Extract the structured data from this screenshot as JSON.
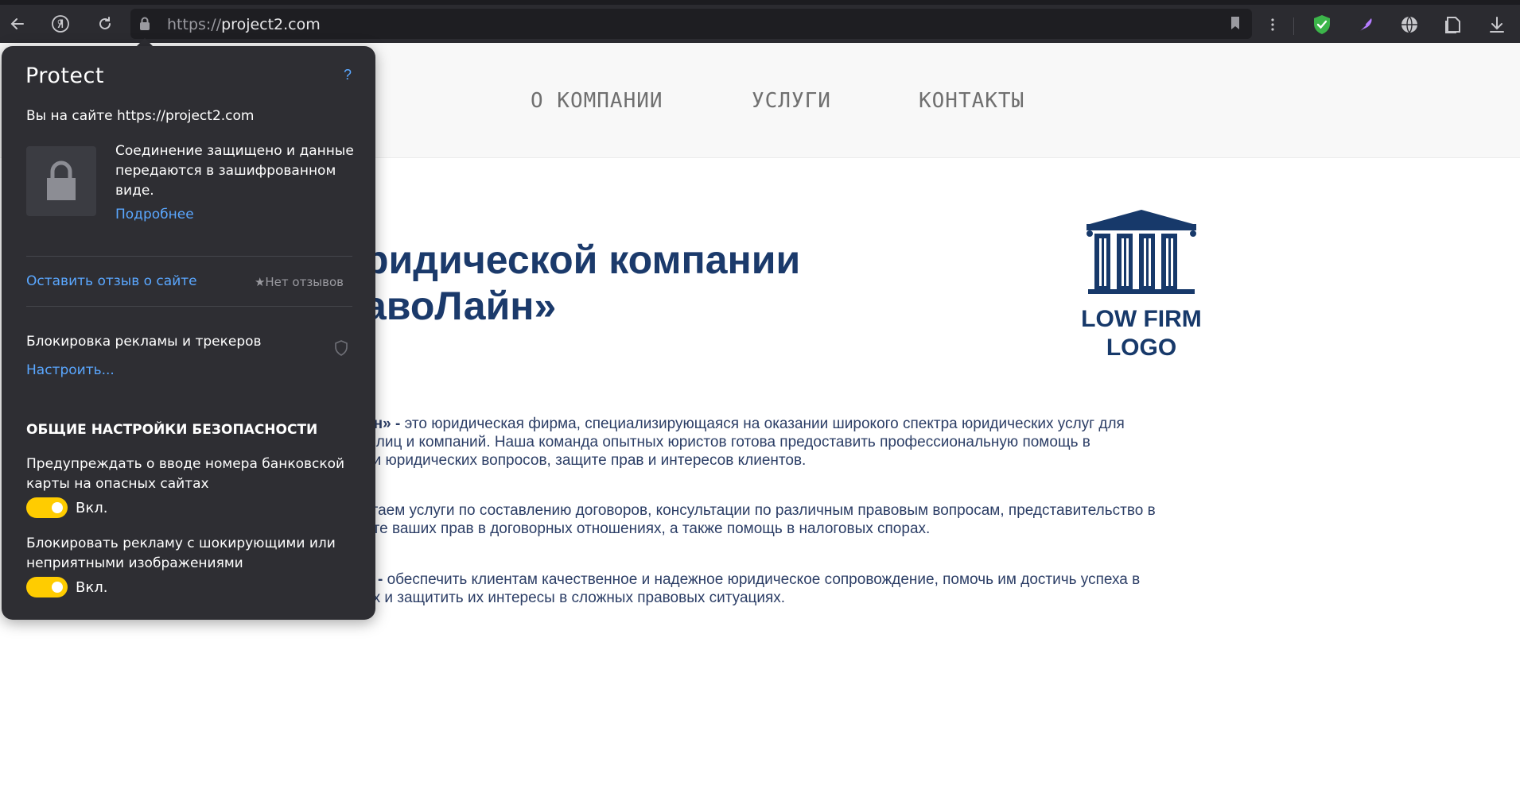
{
  "browser": {
    "url_scheme": "https://",
    "url_host": "project2.com"
  },
  "site": {
    "nav": [
      "О КОМПАНИИ",
      "УСЛУГИ",
      "КОНТАКТЫ"
    ],
    "hero_line1": "ридической компании",
    "hero_line2": "авоЛайн»",
    "logo_line1": "LOW FIRM",
    "logo_line2": "LOGO",
    "para1": {
      "line1_bold": "йн» -",
      "line1": " это юридическая фирма, специализирующаяся на оказании широкого спектра юридических услуг для",
      "line2": "х лиц и компаний. Наша команда опытных юристов готова предоставить профессиональную помощь в",
      "line3": "ии юридических вопросов, защите прав и интересов клиентов."
    },
    "para2": {
      "line1": "агаем услуги по составлению договоров, консультации по различным правовым вопросам, представительство в",
      "line2": "ите ваших прав в договорных отношениях, а также помощь в налоговых спорах."
    },
    "para3": {
      "line1_bold": "ь -",
      "line1": " обеспечить клиентам качественное и надежное юридическое сопровождение, помочь им достичь успеха в",
      "line2": "ах и защитить их интересы в сложных правовых ситуациях."
    }
  },
  "protect": {
    "title": "Protect",
    "help": "?",
    "site_line": "Вы на сайте https://project2.com",
    "connection_text": "Соединение защищено и данные передаются в зашифрованном виде.",
    "more_link": "Подробнее",
    "feedback_link": "Оставить отзыв о сайте",
    "no_reviews": "Нет отзывов",
    "block_label": "Блокировка рекламы и трекеров",
    "configure_link": "Настроить...",
    "section_title": "ОБЩИЕ НАСТРОЙКИ БЕЗОПАСНОСТИ",
    "setting1": "Предупреждать о вводе номера банковской карты на опасных сайтах",
    "setting1_state": "Вкл.",
    "setting2": "Блокировать рекламу с шокирующими или неприятными изображениями",
    "setting2_state": "Вкл."
  },
  "colors": {
    "accent_link": "#5aa7ff",
    "toggle_on": "#ffcc00",
    "brand_blue": "#1b3a6b"
  }
}
